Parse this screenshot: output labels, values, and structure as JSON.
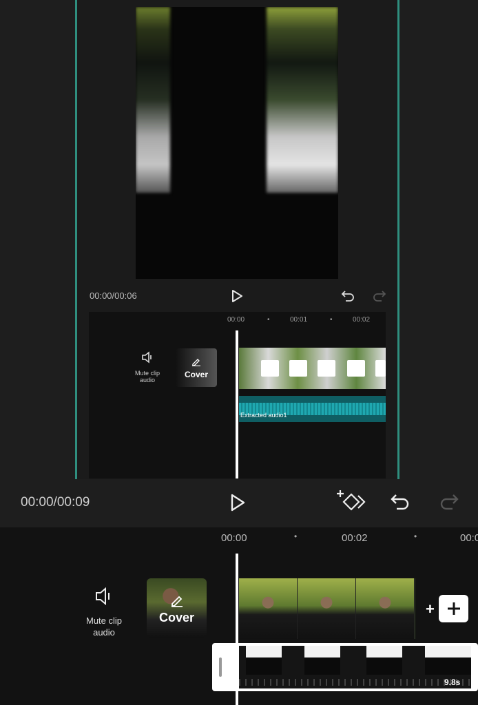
{
  "inner_app": {
    "time": "00:00/00:06",
    "ruler_ticks": [
      "00:00",
      "00:01",
      "00:02"
    ],
    "mute_label": "Mute clip audio",
    "cover_label": "Cover",
    "audio_track_label": "Extracted audio1"
  },
  "outer_app": {
    "time": "00:00/00:09",
    "ruler_ticks": [
      "00:00",
      "00:02",
      "00:0"
    ],
    "mute_label": "Mute clip audio",
    "cover_label": "Cover",
    "clip_duration": "9.8s"
  },
  "colors": {
    "accent_teal": "#2f8f7f",
    "audio_track": "#1fa8b0",
    "background": "#1e1e1e"
  }
}
